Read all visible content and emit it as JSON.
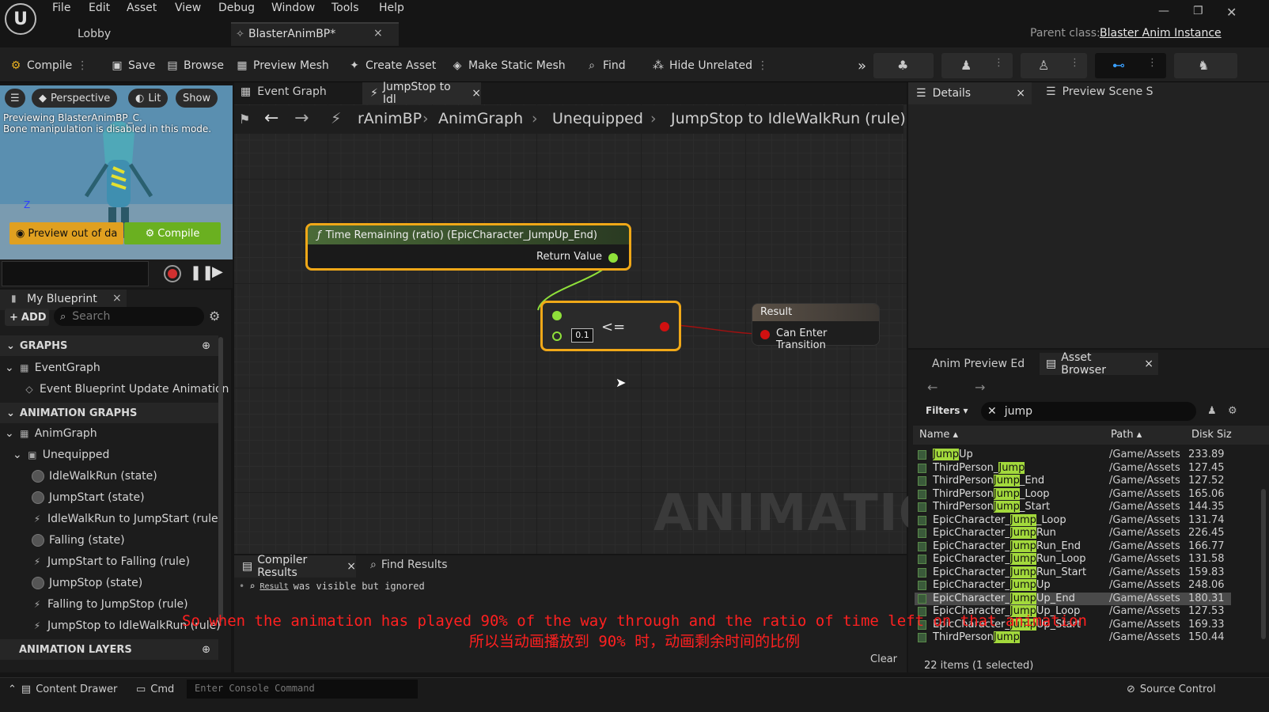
{
  "menubar": {
    "items": [
      "File",
      "Edit",
      "Asset",
      "View",
      "Debug",
      "Window",
      "Tools",
      "Help"
    ],
    "doc_tabs": [
      "Lobby",
      "BlasterAnimBP*"
    ],
    "parent_class_label": "Parent class:",
    "parent_class_value": "Blaster Anim Instance"
  },
  "toolbar": {
    "compile": "Compile",
    "save": "Save",
    "browse": "Browse",
    "preview_mesh": "Preview Mesh",
    "create_asset": "Create Asset",
    "make_static_mesh": "Make Static Mesh",
    "find": "Find",
    "hide_unrelated": "Hide Unrelated"
  },
  "viewport": {
    "perspective": "Perspective",
    "lit": "Lit",
    "show": "Show",
    "msg_line1": "Previewing BlasterAnimBP_C.",
    "msg_line2": "Bone manipulation is disabled in this mode.",
    "preview_btn": "Preview out of da",
    "compile_btn": "Compile",
    "axis_label": "Z"
  },
  "my_blueprint": {
    "tab": "My Blueprint",
    "add": "ADD",
    "search_placeholder": "Search",
    "graphs_header": "GRAPHS",
    "event_graph": "EventGraph",
    "event_update": "Event Blueprint Update Animation",
    "anim_graphs_header": "ANIMATION GRAPHS",
    "anim_graph": "AnimGraph",
    "unequipped": "Unequipped",
    "items": [
      "IdleWalkRun (state)",
      "JumpStart (state)",
      "IdleWalkRun to JumpStart (rule)",
      "Falling (state)",
      "JumpStart to Falling (rule)",
      "JumpStop (state)",
      "Falling to JumpStop (rule)",
      "JumpStop to IdleWalkRun (rule)"
    ],
    "anim_layers_header": "ANIMATION LAYERS"
  },
  "graph": {
    "tabs": [
      "Event Graph",
      "JumpStop to Idl"
    ],
    "breadcrumb": [
      "rAnimBP",
      "AnimGraph",
      "Unequipped",
      "JumpStop to IdleWalkRun (rule)"
    ],
    "node_time_title": "Time Remaining (ratio) (EpicCharacter_JumpUp_End)",
    "node_time_pin": "Return Value",
    "node_compare_op": "<=",
    "node_compare_value": "0.1",
    "node_result_title": "Result",
    "node_result_pin": "Can Enter Transition",
    "watermark": "ANIMATION"
  },
  "compiler": {
    "tab_compiler": "Compiler Results",
    "tab_find": "Find Results",
    "msg_link": "Result",
    "msg_text": "was visible but ignored",
    "clear": "Clear"
  },
  "details": {
    "tab_details": "Details",
    "tab_preview": "Preview Scene S"
  },
  "asset_browser": {
    "tab_anim": "Anim Preview Ed",
    "tab_assets": "Asset Browser",
    "filters": "Filters",
    "search_value": "jump",
    "col_name": "Name",
    "col_path": "Path",
    "col_size": "Disk Siz",
    "rows": [
      {
        "pre": "",
        "hl": "Jump",
        "post": "Up",
        "path": "/Game/Assets",
        "size": "233.89"
      },
      {
        "pre": "ThirdPerson_",
        "hl": "Jump",
        "post": "",
        "path": "/Game/Assets",
        "size": "127.45"
      },
      {
        "pre": "ThirdPerson",
        "hl": "Jump",
        "post": "_End",
        "path": "/Game/Assets",
        "size": "127.52"
      },
      {
        "pre": "ThirdPerson",
        "hl": "Jump",
        "post": "_Loop",
        "path": "/Game/Assets",
        "size": "165.06"
      },
      {
        "pre": "ThirdPerson",
        "hl": "Jump",
        "post": "_Start",
        "path": "/Game/Assets",
        "size": "144.35"
      },
      {
        "pre": "EpicCharacter_",
        "hl": "Jump",
        "post": "_Loop",
        "path": "/Game/Assets",
        "size": "131.74"
      },
      {
        "pre": "EpicCharacter_",
        "hl": "Jump",
        "post": "Run",
        "path": "/Game/Assets",
        "size": "226.45"
      },
      {
        "pre": "EpicCharacter_",
        "hl": "Jump",
        "post": "Run_End",
        "path": "/Game/Assets",
        "size": "166.77"
      },
      {
        "pre": "EpicCharacter_",
        "hl": "Jump",
        "post": "Run_Loop",
        "path": "/Game/Assets",
        "size": "131.58"
      },
      {
        "pre": "EpicCharacter_",
        "hl": "Jump",
        "post": "Run_Start",
        "path": "/Game/Assets",
        "size": "159.83"
      },
      {
        "pre": "EpicCharacter_",
        "hl": "Jump",
        "post": "Up",
        "path": "/Game/Assets",
        "size": "248.06"
      },
      {
        "pre": "EpicCharacter_",
        "hl": "Jump",
        "post": "Up_End",
        "path": "/Game/Assets",
        "size": "180.31"
      },
      {
        "pre": "EpicCharacter_",
        "hl": "Jump",
        "post": "Up_Loop",
        "path": "/Game/Assets",
        "size": "127.53"
      },
      {
        "pre": "EpicCharacter_",
        "hl": "Jump",
        "post": "Up_Start",
        "path": "/Game/Assets",
        "size": "169.33"
      },
      {
        "pre": "ThirdPerson",
        "hl": "Jump",
        "post": "",
        "path": "/Game/Assets",
        "size": "150.44"
      }
    ],
    "selected_index": 11,
    "count": "22 items (1 selected)"
  },
  "subtitles": {
    "en": "So when the animation has played 90% of the way through and the ratio of time left on that animation",
    "zh": "所以当动画播放到 90% 时，动画剩余时间的比例"
  },
  "statusbar": {
    "content_drawer": "Content Drawer",
    "cmd": "Cmd",
    "console_placeholder": "Enter Console Command",
    "source_control": "Source Control"
  },
  "colors": {
    "node_border": "#f0a818",
    "pin_green": "#8fe03a",
    "pin_red": "#d01010",
    "highlight": "#a3d93c",
    "subtitle": "#ff2020"
  }
}
